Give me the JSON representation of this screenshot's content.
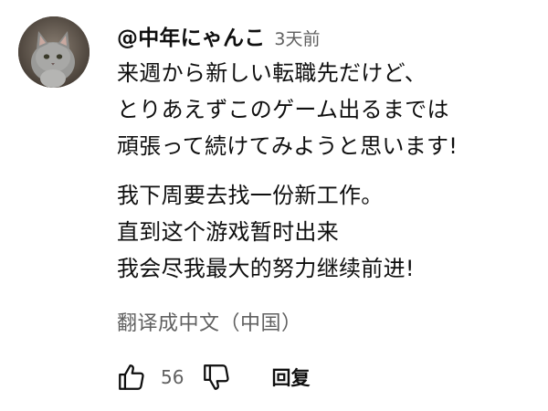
{
  "comment": {
    "author": "@中年にゃんこ",
    "timestamp": "3天前",
    "avatar_icon": "cat-avatar-icon",
    "original_lines": [
      "来週から新しい転職先だけど、",
      "とりあえずこのゲーム出るまでは",
      "頑張って続けてみようと思います!"
    ],
    "translated_lines": [
      "我下周要去找一份新工作。",
      "直到这个游戏暂时出来",
      "我会尽我最大的努力继续前进!"
    ],
    "translate_label": "翻译成中文（中国）",
    "like_count": "56",
    "like_icon": "thumbs-up-icon",
    "dislike_icon": "thumbs-down-icon",
    "reply_label": "回复"
  }
}
